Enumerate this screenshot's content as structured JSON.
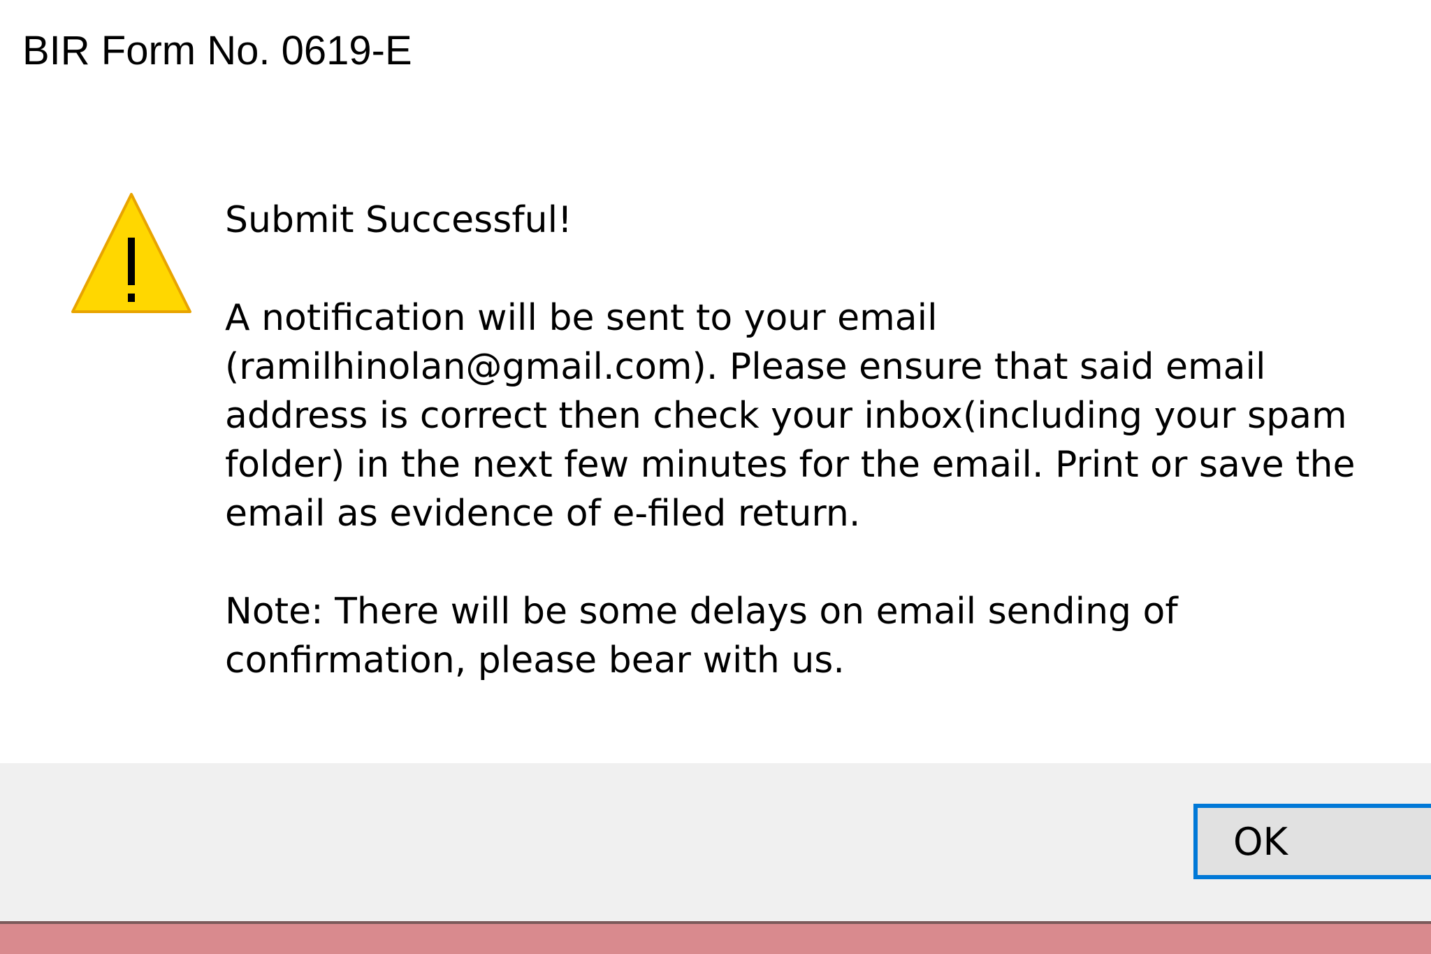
{
  "window": {
    "title": "BIR Form No. 0619-E"
  },
  "message": {
    "heading": "Submit Successful!",
    "body_lines": [
      "A notification will be sent to your email",
      "(ramilhinolan@gmail.com). Please ensure that said email",
      "address is correct then check your inbox(including your spam",
      "folder) in the next few minutes for the email. Print or save the",
      "email as evidence of e-filed return."
    ],
    "note_lines": [
      "Note: There will be some delays on email sending of",
      "confirmation, please bear with us."
    ]
  },
  "buttons": {
    "ok_label": "OK"
  },
  "icons": {
    "warning": "warning-triangle-icon"
  },
  "colors": {
    "warning_fill": "#FFD700",
    "warning_stroke": "#E8A400",
    "focus_border": "#0078D7",
    "button_bar": "#F0F0F0",
    "button_face": "#E1E1E1",
    "backdrop": "#D98A8E"
  }
}
